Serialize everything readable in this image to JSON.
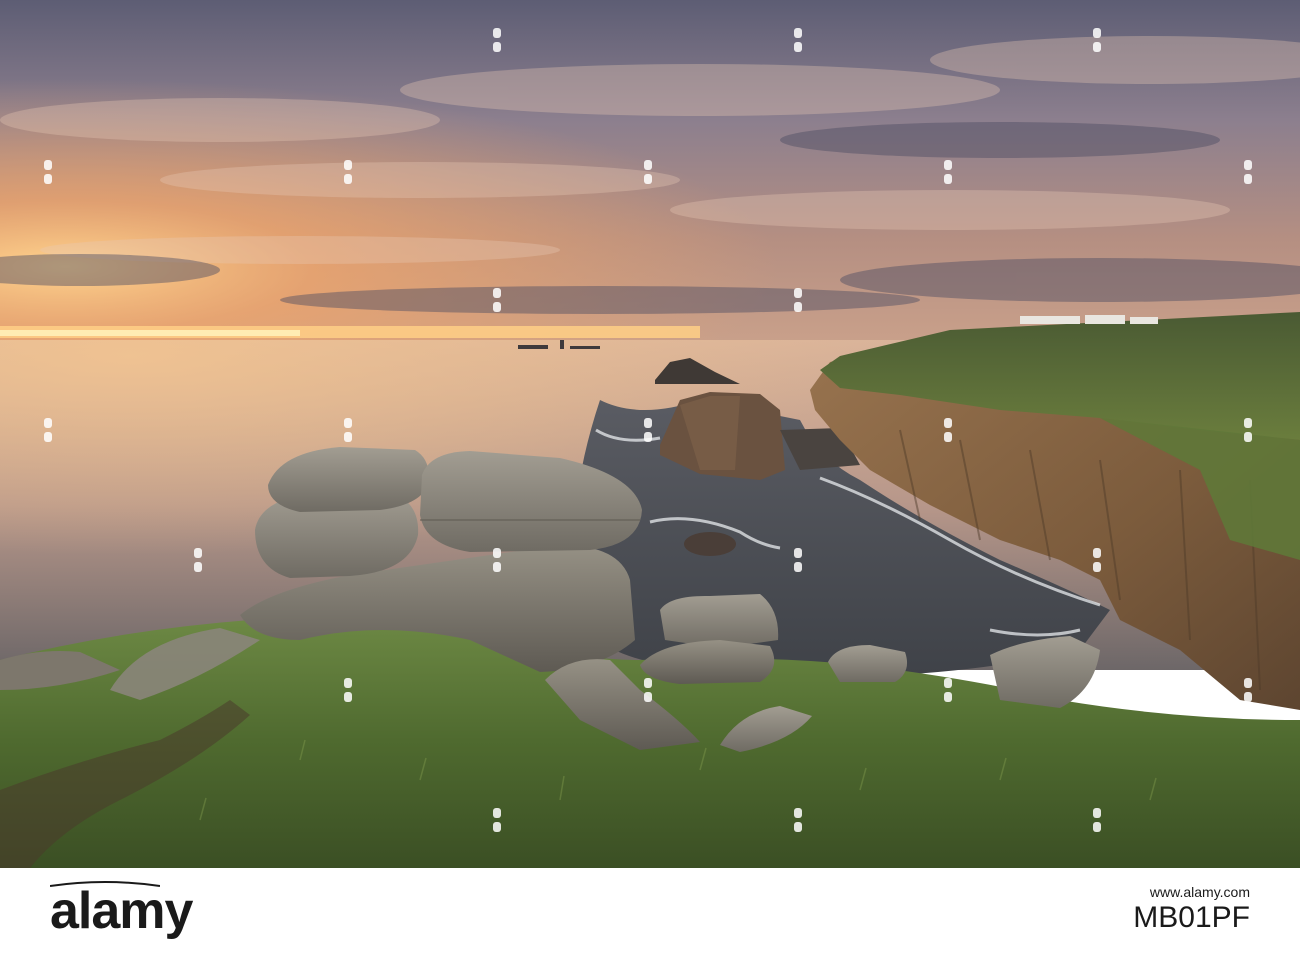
{
  "photo": {
    "subject": "coastal-cliffs-sunset",
    "colors": {
      "sky_top": "#6f6e86",
      "sky_glow": "#f4b36e",
      "horizon": "#ffd08a",
      "sea": "#c9a88f",
      "sea_dark": "#4e545d",
      "cliff": "#8a6a45",
      "grass": "#5f7a3a",
      "boulder": "#8e8a80"
    },
    "watermark_text": "alamy"
  },
  "footer": {
    "logo_text": "alamy",
    "site_url": "www.alamy.com",
    "image_id": "MB01PF"
  }
}
